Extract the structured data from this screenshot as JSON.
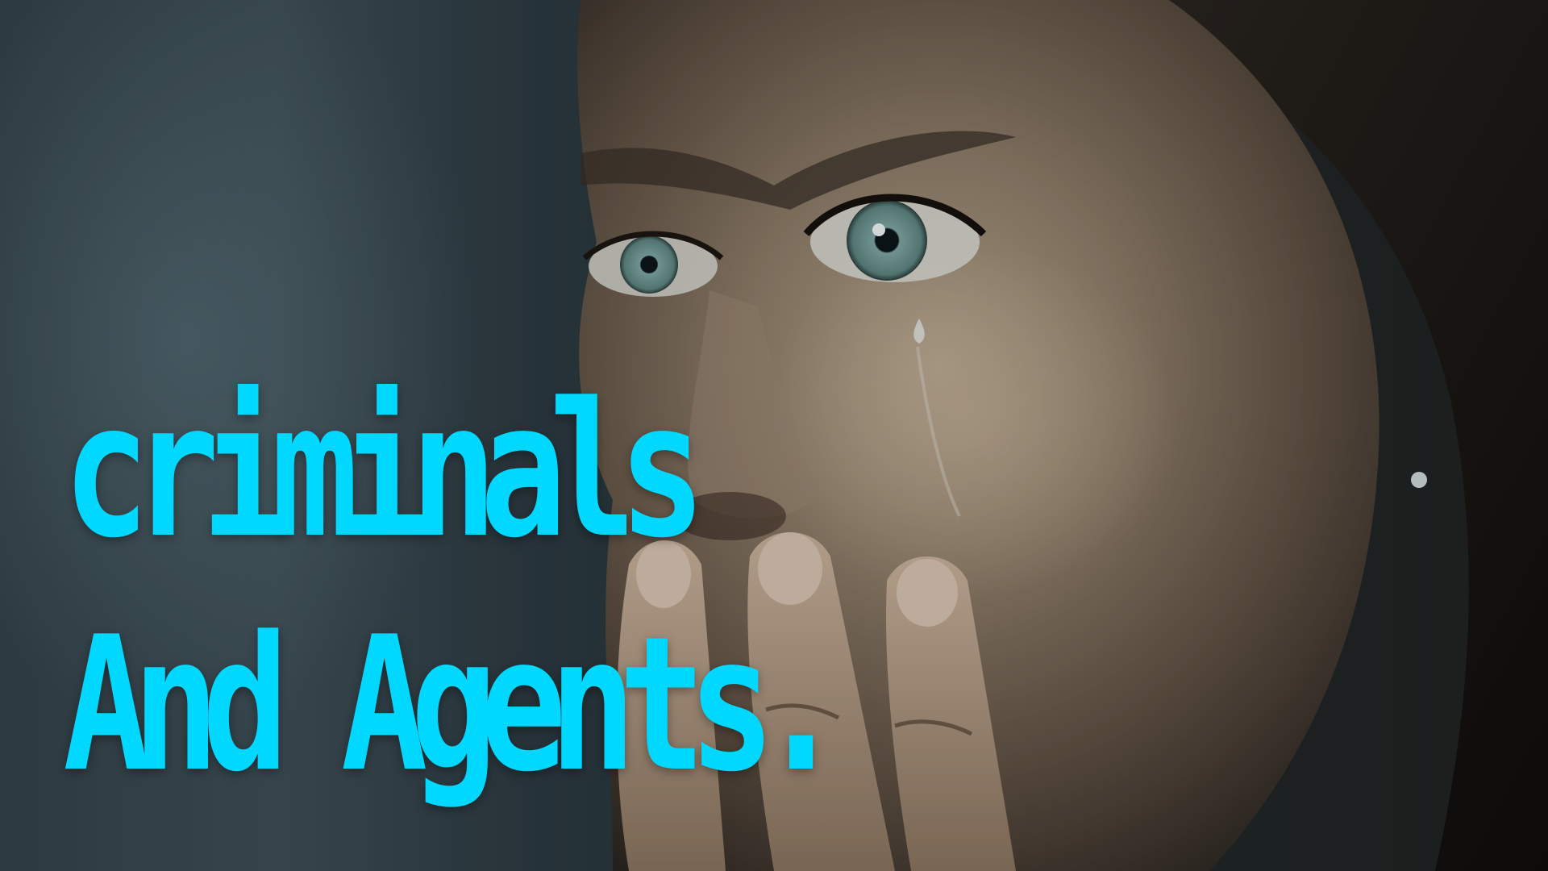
{
  "headline": {
    "line1": "criminals",
    "line2": "And Agents."
  },
  "colors": {
    "headline": "#00d8ff",
    "background": "#2e3c43"
  }
}
